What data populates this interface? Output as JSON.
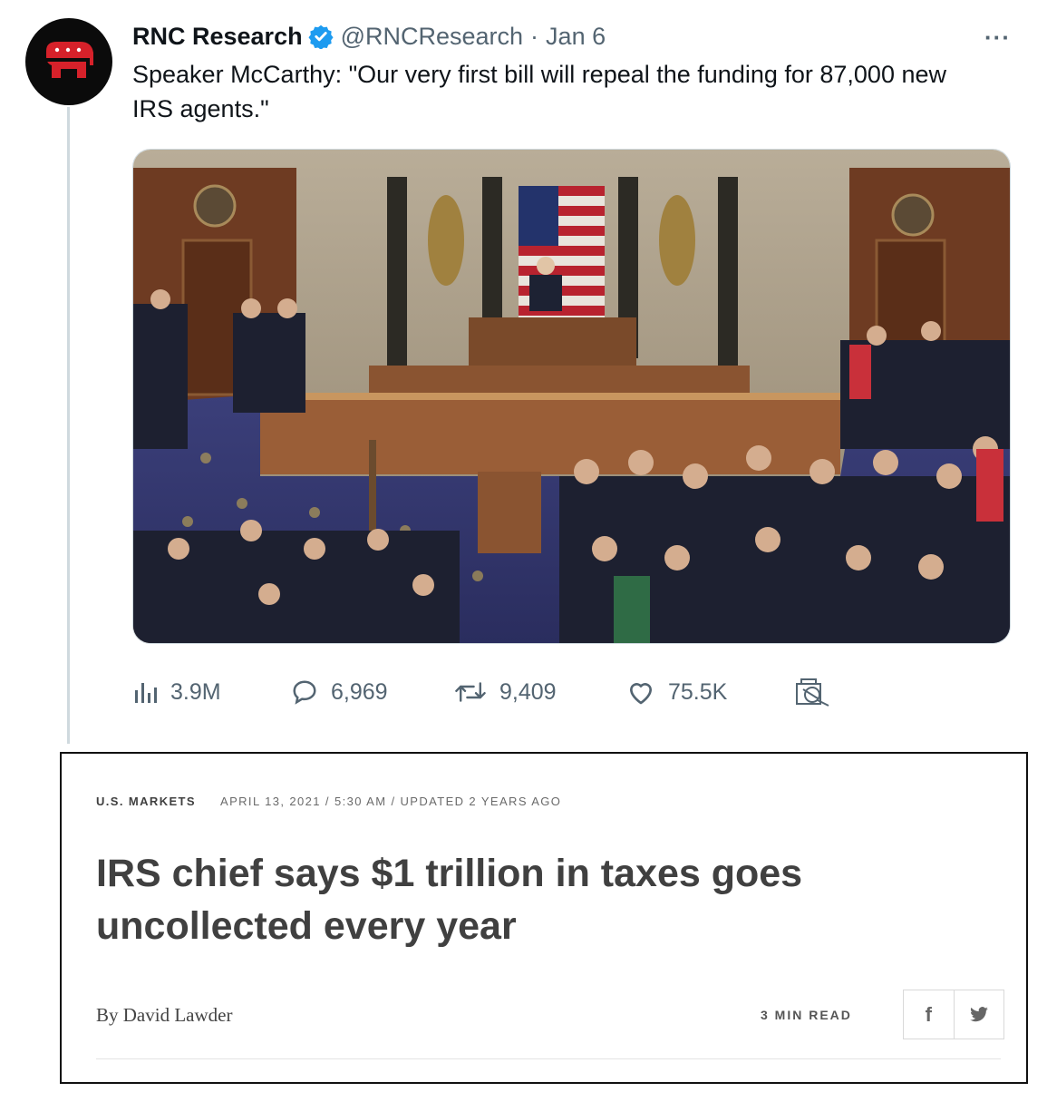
{
  "tweet": {
    "author": "RNC Research",
    "handle": "@RNCResearch",
    "separator": "·",
    "date": "Jan 6",
    "more_icon": "more-icon",
    "text": "Speaker McCarthy: \"Our very first bill will repeal the funding for 87,000 new IRS agents.\"",
    "media_icon": "photo-house-chamber",
    "stats": {
      "views": "3.9M",
      "replies": "6,969",
      "retweets": "9,409",
      "likes": "75.5K"
    },
    "colors": {
      "verified": "#1d9bf0",
      "muted": "#536471",
      "avatar_logo": "#d6212a"
    }
  },
  "article": {
    "section": "U.S. MARKETS",
    "dateline": "APRIL 13, 2021 / 5:30 AM / UPDATED 2 YEARS AGO",
    "headline": "IRS chief says $1 trillion in taxes goes uncollected every year",
    "byline": "By David Lawder",
    "read_time": "3 MIN READ",
    "share": [
      "facebook-icon",
      "twitter-icon"
    ]
  }
}
